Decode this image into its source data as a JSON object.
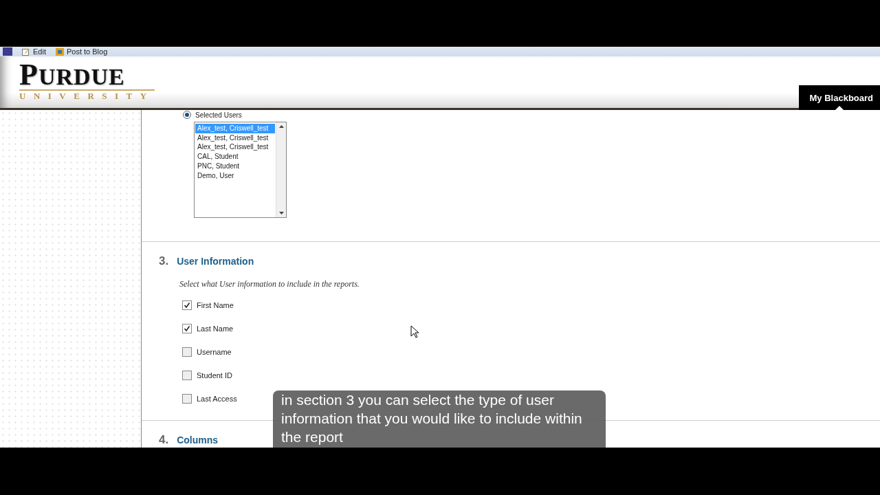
{
  "browser_toolbar": {
    "items": [
      {
        "label": "Edit",
        "kind": "edit"
      },
      {
        "label": "Post to Blog",
        "kind": "blog"
      }
    ]
  },
  "header": {
    "logo": {
      "name": "PURDUE",
      "subtitle": "UNIVERSITY"
    },
    "tab": {
      "label": "My Blackboard",
      "selected": true
    }
  },
  "user_selection": {
    "option": {
      "label": "Selected Users",
      "selected": true
    },
    "users": [
      {
        "name": "Alex_test, Criswell_test",
        "selected": true
      },
      {
        "name": "Alex_test, Criswell_test",
        "selected": false
      },
      {
        "name": "Alex_test, Criswell_test",
        "selected": false
      },
      {
        "name": "CAL, Student",
        "selected": false
      },
      {
        "name": "PNC, Student",
        "selected": false
      },
      {
        "name": "Demo, User",
        "selected": false
      }
    ]
  },
  "sections": [
    {
      "number": "3.",
      "title": "User Information",
      "description": "Select what User information to include in the reports.",
      "fields": [
        {
          "label": "First Name",
          "checked": true
        },
        {
          "label": "Last Name",
          "checked": true
        },
        {
          "label": "Username",
          "checked": false
        },
        {
          "label": "Student ID",
          "checked": false
        },
        {
          "label": "Last Access",
          "checked": false
        }
      ]
    },
    {
      "number": "4.",
      "title": "Columns"
    }
  ],
  "caption": "in section 3 you can select the type of user information that you would like to include within the report"
}
